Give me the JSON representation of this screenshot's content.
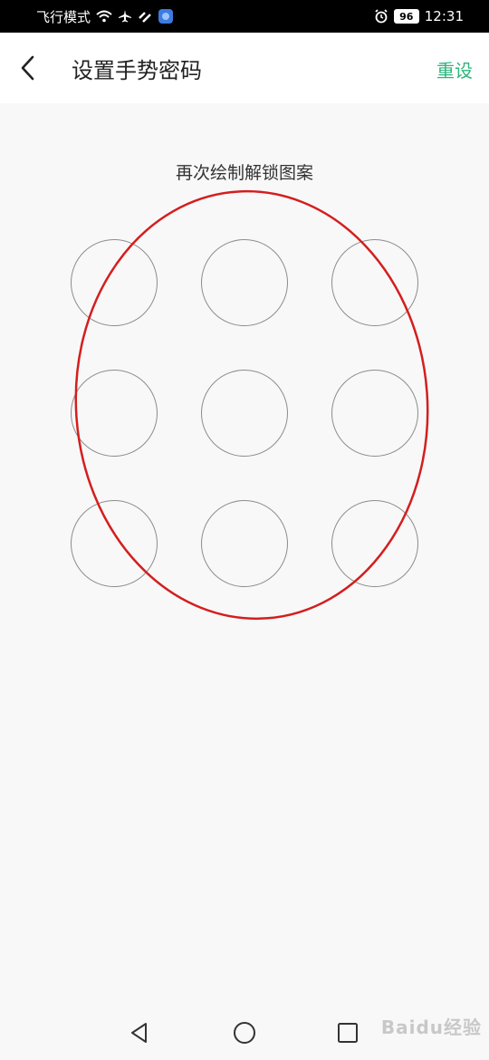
{
  "status_bar": {
    "airplane_mode_label": "飞行模式",
    "battery": "96",
    "time": "12:31",
    "icons": [
      "wifi-icon",
      "airplane-icon",
      "signal-icon",
      "app-notification-icon",
      "alarm-icon",
      "battery-icon"
    ]
  },
  "header": {
    "title": "设置手势密码",
    "reset_label": "重设",
    "accent_color": "#2db67c"
  },
  "pattern": {
    "hint": "再次绘制解锁图案",
    "dots": [
      1,
      2,
      3,
      4,
      5,
      6,
      7,
      8,
      9
    ]
  },
  "navbar": {
    "icons": [
      "back-triangle-icon",
      "home-circle-icon",
      "recents-square-icon"
    ]
  },
  "watermark": "Baidu经验"
}
